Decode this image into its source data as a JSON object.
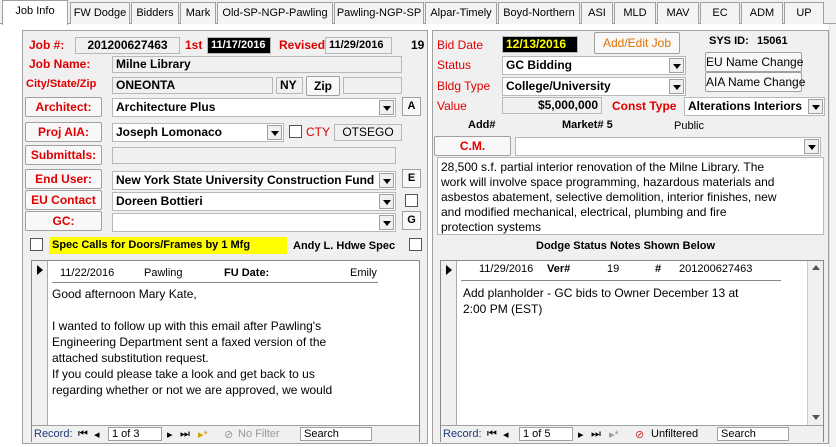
{
  "tabs": [
    "Job Info",
    "FW Dodge",
    "Bidders",
    "Mark",
    "Old-SP-NGP-Pawling",
    "Pawling-NGP-SP",
    "Alpar-Timely",
    "Boyd-Northern",
    "ASI",
    "MLD",
    "MAV",
    "EC",
    "ADM",
    "UP"
  ],
  "left": {
    "job_no_label": "Job #:",
    "job_no": "201200627463",
    "first_label": "1st",
    "first_date": "11/17/2016",
    "revised_label": "Revised",
    "revised_date": "11/29/2016",
    "revised_count": "19",
    "job_name_label": "Job Name:",
    "job_name": "Milne Library",
    "city_label": "City/State/Zip",
    "city": "ONEONTA",
    "state": "NY",
    "zip_button": "Zip",
    "architect_button": "Architect:",
    "architect": "Architecture Plus",
    "architect_btn_letter": "A",
    "proj_aia_button": "Proj AIA:",
    "proj_aia": "Joseph Lomonaco",
    "cty_label": "CTY",
    "county": "OTSEGO",
    "submittals_button": "Submittals:",
    "end_user_button": "End User:",
    "end_user": "New York State University Construction Fund",
    "end_user_btn_letter": "E",
    "eu_contact_button": "EU Contact",
    "eu_contact": "Doreen Bottieri",
    "gc_button": "GC:",
    "gc_btn_letter": "G",
    "spec_calls": "Spec Calls for Doors/Frames by 1 Mfg",
    "hdwe_spec": "Andy L. Hdwe Spec"
  },
  "left_note": {
    "date": "11/22/2016",
    "company": "Pawling",
    "fu_label": "FU Date:",
    "author": "Emily",
    "body": "Good afternoon Mary Kate,\n\nI wanted to follow up with this email after Pawling's\nEngineering Department sent a faxed version of the\nattached substitution request.\nIf you could please take a look and get back to us\nregarding whether or not we are approved, we would",
    "nav_record": "Record:",
    "nav_pos": "1 of 3",
    "nav_filter": "No Filter",
    "nav_search": "Search"
  },
  "right": {
    "bid_date_label": "Bid Date",
    "bid_date": "12/13/2016",
    "add_edit_button": "Add/Edit Job",
    "sys_id_label": "SYS ID:",
    "sys_id": "15061",
    "status_label": "Status",
    "status": "GC Bidding",
    "eu_name_change": "EU Name Change",
    "bldg_type_label": "Bldg Type",
    "bldg_type": "College/University",
    "aia_name_change": "AIA Name Change",
    "value_label": "Value",
    "value": "$5,000,000",
    "const_type_label": "Const Type",
    "const_type": "Alterations Interiors",
    "add_no_label": "Add#",
    "market_label": "Market# 5",
    "public_label": "Public",
    "cm_button": "C.M.",
    "description": "28,500 s.f. partial interior renovation of the Milne Library. The\nwork will involve space programming, hazardous materials and\nasbestos abatement, selective demolition, interior finishes, new\nand modified mechanical, electrical, plumbing and fire\nprotection systems",
    "dodge_header": "Dodge Status Notes Shown Below"
  },
  "right_note": {
    "date": "11/29/2016",
    "ver_label": "Ver#",
    "ver": "19",
    "hash_label": "#",
    "job_no": "201200627463",
    "body": "Add planholder - GC bids to Owner December 13 at\n2:00 PM (EST)",
    "nav_record": "Record:",
    "nav_pos": "1 of 5",
    "nav_filter": "Unfiltered",
    "nav_search": "Search"
  },
  "colors": {
    "label_red": "#e00000",
    "highlight_yellow": "#ffff00",
    "date_black": "#000000"
  }
}
